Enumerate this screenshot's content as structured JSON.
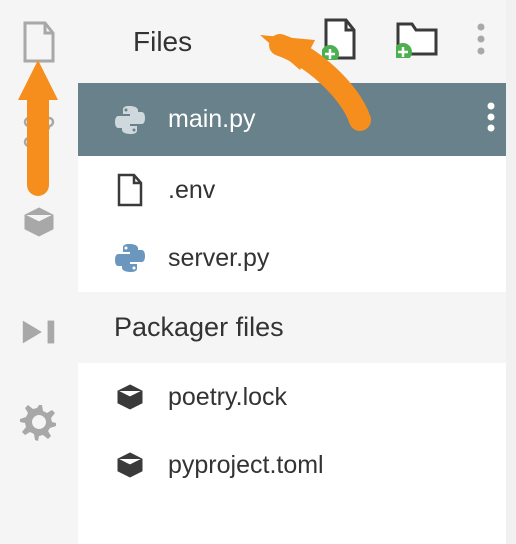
{
  "header": {
    "title": "Files"
  },
  "files": {
    "items": [
      {
        "label": "main.py",
        "type": "python",
        "selected": true
      },
      {
        "label": ".env",
        "type": "file",
        "selected": false
      },
      {
        "label": "server.py",
        "type": "python",
        "selected": false
      }
    ]
  },
  "packager": {
    "title": "Packager files",
    "items": [
      {
        "label": "poetry.lock",
        "type": "package"
      },
      {
        "label": "pyproject.toml",
        "type": "package"
      }
    ]
  },
  "colors": {
    "accent_orange": "#f68e1e",
    "selected_bg": "#68818a",
    "python_blue": "#6b97bf",
    "icon_gray": "#a8a8a8",
    "add_badge": "#4caf50"
  }
}
